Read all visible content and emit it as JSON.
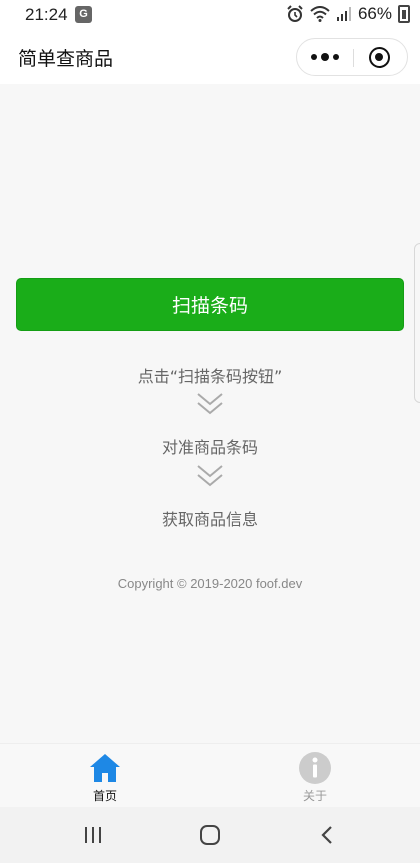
{
  "status_bar": {
    "time": "21:24",
    "battery": "66%",
    "icons": [
      "translate-icon",
      "alarm-icon",
      "wifi-icon",
      "signal-icon",
      "battery-icon"
    ]
  },
  "nav": {
    "title": "简单查商品",
    "menu_icon": "more-dots-icon",
    "close_icon": "target-close-icon"
  },
  "main": {
    "scan_button": "扫描条码",
    "steps": [
      "点击“扫描条码按钮”",
      "对准商品条码",
      "获取商品信息"
    ],
    "step_separator_icon": "double-chevron-down-icon",
    "copyright": "Copyright © 2019-2020 foof.dev"
  },
  "tabbar": {
    "items": [
      {
        "label": "首页",
        "icon": "home-icon",
        "active": true
      },
      {
        "label": "关于",
        "icon": "info-icon",
        "active": false
      }
    ],
    "active_color": "#1e88e5",
    "inactive_color": "#cccccc"
  },
  "system_nav": {
    "icons": [
      "recents-icon",
      "home-circle-icon",
      "back-icon"
    ]
  },
  "colors": {
    "accent": "#1aad19",
    "background": "#f7f7f7"
  }
}
